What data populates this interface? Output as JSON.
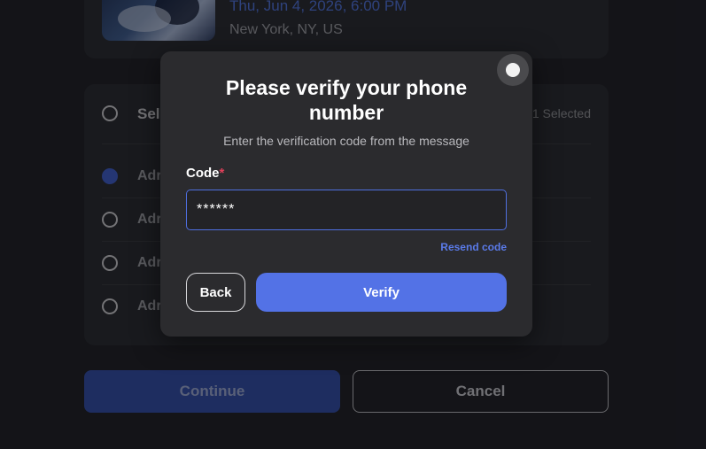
{
  "event": {
    "date": "Thu, Jun 4, 2026, 6:00 PM",
    "location": "New York, NY, US"
  },
  "tickets": {
    "select_label": "Sel",
    "selected_count": "1 Selected",
    "rows": [
      {
        "label": "Adr",
        "selected": true
      },
      {
        "label": "Adr",
        "selected": false
      },
      {
        "label": "Adr",
        "selected": false
      },
      {
        "label": "Adr",
        "selected": false
      }
    ]
  },
  "footer": {
    "continue_label": "Continue",
    "cancel_label": "Cancel"
  },
  "modal": {
    "title": "Please verify your phone number",
    "subtitle": "Enter the verification code from the message",
    "code_label": "Code",
    "required_marker": "*",
    "code_value": "******",
    "resend_label": "Resend code",
    "back_label": "Back",
    "verify_label": "Verify",
    "close_icon": "close-icon"
  },
  "colors": {
    "accent": "#5372e6",
    "required": "#e0405a",
    "background": "#1c1d22"
  }
}
